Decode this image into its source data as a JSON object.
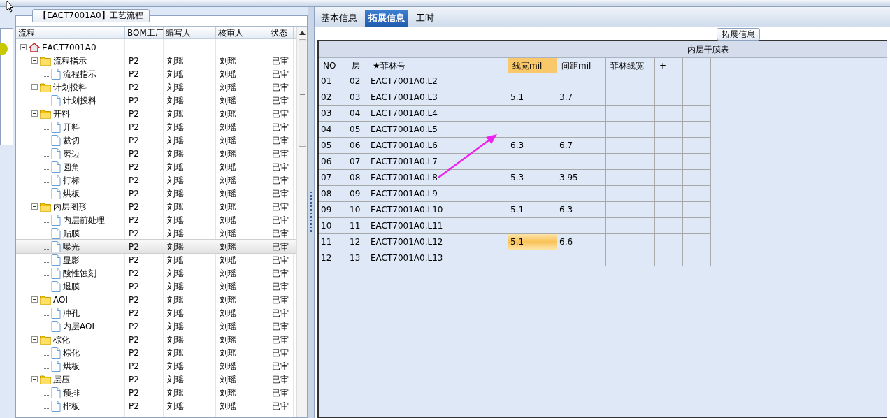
{
  "left_panel": {
    "title": "【EACT7001A0】工艺流程",
    "columns": [
      "流程",
      "BOM工厂",
      "编写人",
      "核审人",
      "状态"
    ],
    "tree": [
      {
        "label": "EACT7001A0",
        "kind": "root",
        "expanded": true,
        "selected": false,
        "children": [
          {
            "label": "流程指示",
            "kind": "folder",
            "expanded": true,
            "selected": false,
            "bom": "P2",
            "writer": "刘瑶",
            "reviewer": "刘瑶",
            "status": "已审",
            "children": [
              {
                "label": "流程指示",
                "kind": "file",
                "selected": false,
                "bom": "P2",
                "writer": "刘瑶",
                "reviewer": "刘瑶",
                "status": "已审"
              }
            ]
          },
          {
            "label": "计划投料",
            "kind": "folder",
            "expanded": true,
            "selected": false,
            "bom": "P2",
            "writer": "刘瑶",
            "reviewer": "刘瑶",
            "status": "已审",
            "children": [
              {
                "label": "计划投料",
                "kind": "file",
                "selected": false,
                "bom": "P2",
                "writer": "刘瑶",
                "reviewer": "刘瑶",
                "status": "已审"
              }
            ]
          },
          {
            "label": "开料",
            "kind": "folder",
            "expanded": true,
            "selected": false,
            "bom": "P2",
            "writer": "刘瑶",
            "reviewer": "刘瑶",
            "status": "已审",
            "children": [
              {
                "label": "开料",
                "kind": "file",
                "selected": false,
                "bom": "P2",
                "writer": "刘瑶",
                "reviewer": "刘瑶",
                "status": "已审"
              },
              {
                "label": "裁切",
                "kind": "file",
                "selected": false,
                "bom": "P2",
                "writer": "刘瑶",
                "reviewer": "刘瑶",
                "status": "已审"
              },
              {
                "label": "磨边",
                "kind": "file",
                "selected": false,
                "bom": "P2",
                "writer": "刘瑶",
                "reviewer": "刘瑶",
                "status": "已审"
              },
              {
                "label": "圆角",
                "kind": "file",
                "selected": false,
                "bom": "P2",
                "writer": "刘瑶",
                "reviewer": "刘瑶",
                "status": "已审"
              },
              {
                "label": "打标",
                "kind": "file",
                "selected": false,
                "bom": "P2",
                "writer": "刘瑶",
                "reviewer": "刘瑶",
                "status": "已审"
              },
              {
                "label": "烘板",
                "kind": "file",
                "selected": false,
                "bom": "P2",
                "writer": "刘瑶",
                "reviewer": "刘瑶",
                "status": "已审"
              }
            ]
          },
          {
            "label": "内层图形",
            "kind": "folder",
            "expanded": true,
            "selected": false,
            "bom": "P2",
            "writer": "刘瑶",
            "reviewer": "刘瑶",
            "status": "已审",
            "children": [
              {
                "label": "内层前处理",
                "kind": "file",
                "selected": false,
                "bom": "P2",
                "writer": "刘瑶",
                "reviewer": "刘瑶",
                "status": "已审"
              },
              {
                "label": "贴膜",
                "kind": "file",
                "selected": false,
                "bom": "P2",
                "writer": "刘瑶",
                "reviewer": "刘瑶",
                "status": "已审"
              },
              {
                "label": "曝光",
                "kind": "file",
                "selected": true,
                "bom": "P2",
                "writer": "刘瑶",
                "reviewer": "刘瑶",
                "status": "已审"
              },
              {
                "label": "显影",
                "kind": "file",
                "selected": false,
                "bom": "P2",
                "writer": "刘瑶",
                "reviewer": "刘瑶",
                "status": "已审"
              },
              {
                "label": "酸性蚀刻",
                "kind": "file",
                "selected": false,
                "bom": "P2",
                "writer": "刘瑶",
                "reviewer": "刘瑶",
                "status": "已审"
              },
              {
                "label": "退膜",
                "kind": "file",
                "selected": false,
                "bom": "P2",
                "writer": "刘瑶",
                "reviewer": "刘瑶",
                "status": "已审"
              }
            ]
          },
          {
            "label": "AOI",
            "kind": "folder",
            "expanded": true,
            "selected": false,
            "bom": "P2",
            "writer": "刘瑶",
            "reviewer": "刘瑶",
            "status": "已审",
            "children": [
              {
                "label": "冲孔",
                "kind": "file",
                "selected": false,
                "bom": "P2",
                "writer": "刘瑶",
                "reviewer": "刘瑶",
                "status": "已审"
              },
              {
                "label": "内层AOI",
                "kind": "file",
                "selected": false,
                "bom": "P2",
                "writer": "刘瑶",
                "reviewer": "刘瑶",
                "status": "已审"
              }
            ]
          },
          {
            "label": "棕化",
            "kind": "folder",
            "expanded": true,
            "selected": false,
            "bom": "P2",
            "writer": "刘瑶",
            "reviewer": "刘瑶",
            "status": "已审",
            "children": [
              {
                "label": "棕化",
                "kind": "file",
                "selected": false,
                "bom": "P2",
                "writer": "刘瑶",
                "reviewer": "刘瑶",
                "status": "已审"
              },
              {
                "label": "烘板",
                "kind": "file",
                "selected": false,
                "bom": "P2",
                "writer": "刘瑶",
                "reviewer": "刘瑶",
                "status": "已审"
              }
            ]
          },
          {
            "label": "层压",
            "kind": "folder",
            "expanded": true,
            "selected": false,
            "bom": "P2",
            "writer": "刘瑶",
            "reviewer": "刘瑶",
            "status": "已审",
            "children": [
              {
                "label": "预排",
                "kind": "file",
                "selected": false,
                "bom": "P2",
                "writer": "刘瑶",
                "reviewer": "刘瑶",
                "status": "已审"
              },
              {
                "label": "排板",
                "kind": "file",
                "selected": false,
                "bom": "P2",
                "writer": "刘瑶",
                "reviewer": "刘瑶",
                "status": "已审"
              }
            ]
          }
        ]
      }
    ]
  },
  "tabs": [
    {
      "label": "基本信息",
      "selected": false
    },
    {
      "label": "拓展信息",
      "selected": true
    },
    {
      "label": "工时",
      "selected": false
    }
  ],
  "group_label": "拓展信息",
  "table": {
    "title": "内层干膜表",
    "columns": [
      {
        "label": "NO",
        "selected": false
      },
      {
        "label": "层",
        "selected": false
      },
      {
        "label": "★菲林号",
        "selected": false
      },
      {
        "label": "线宽mil",
        "selected": true
      },
      {
        "label": "间距mil",
        "selected": false
      },
      {
        "label": "菲林线宽",
        "selected": false
      },
      {
        "label": "+",
        "selected": false
      },
      {
        "label": "-",
        "selected": false
      }
    ],
    "rows": [
      {
        "selected": false,
        "cells": [
          "01",
          "02",
          "EACT7001A0.L2",
          "",
          "",
          "",
          "",
          ""
        ]
      },
      {
        "selected": false,
        "cells": [
          "02",
          "03",
          "EACT7001A0.L3",
          "5.1",
          "3.7",
          "",
          "",
          ""
        ]
      },
      {
        "selected": false,
        "cells": [
          "03",
          "04",
          "EACT7001A0.L4",
          "",
          "",
          "",
          "",
          ""
        ]
      },
      {
        "selected": false,
        "cells": [
          "04",
          "05",
          "EACT7001A0.L5",
          "",
          "",
          "",
          "",
          ""
        ]
      },
      {
        "selected": false,
        "cells": [
          "05",
          "06",
          "EACT7001A0.L6",
          "6.3",
          "6.7",
          "",
          "",
          ""
        ]
      },
      {
        "selected": false,
        "cells": [
          "06",
          "07",
          "EACT7001A0.L7",
          "",
          "",
          "",
          "",
          ""
        ]
      },
      {
        "selected": false,
        "cells": [
          "07",
          "08",
          "EACT7001A0.L8",
          "5.3",
          "3.95",
          "",
          "",
          ""
        ]
      },
      {
        "selected": false,
        "cells": [
          "08",
          "09",
          "EACT7001A0.L9",
          "",
          "",
          "",
          "",
          ""
        ]
      },
      {
        "selected": false,
        "cells": [
          "09",
          "10",
          "EACT7001A0.L10",
          "5.1",
          "6.3",
          "",
          "",
          ""
        ]
      },
      {
        "selected": false,
        "cells": [
          "10",
          "11",
          "EACT7001A0.L11",
          "",
          "",
          "",
          "",
          ""
        ]
      },
      {
        "selected": true,
        "cells": [
          "11",
          "12",
          "EACT7001A0.L12",
          "5.1",
          "6.6",
          "",
          "",
          ""
        ]
      },
      {
        "selected": false,
        "cells": [
          "12",
          "13",
          "EACT7001A0.L13",
          "",
          "",
          "",
          "",
          ""
        ]
      }
    ]
  }
}
